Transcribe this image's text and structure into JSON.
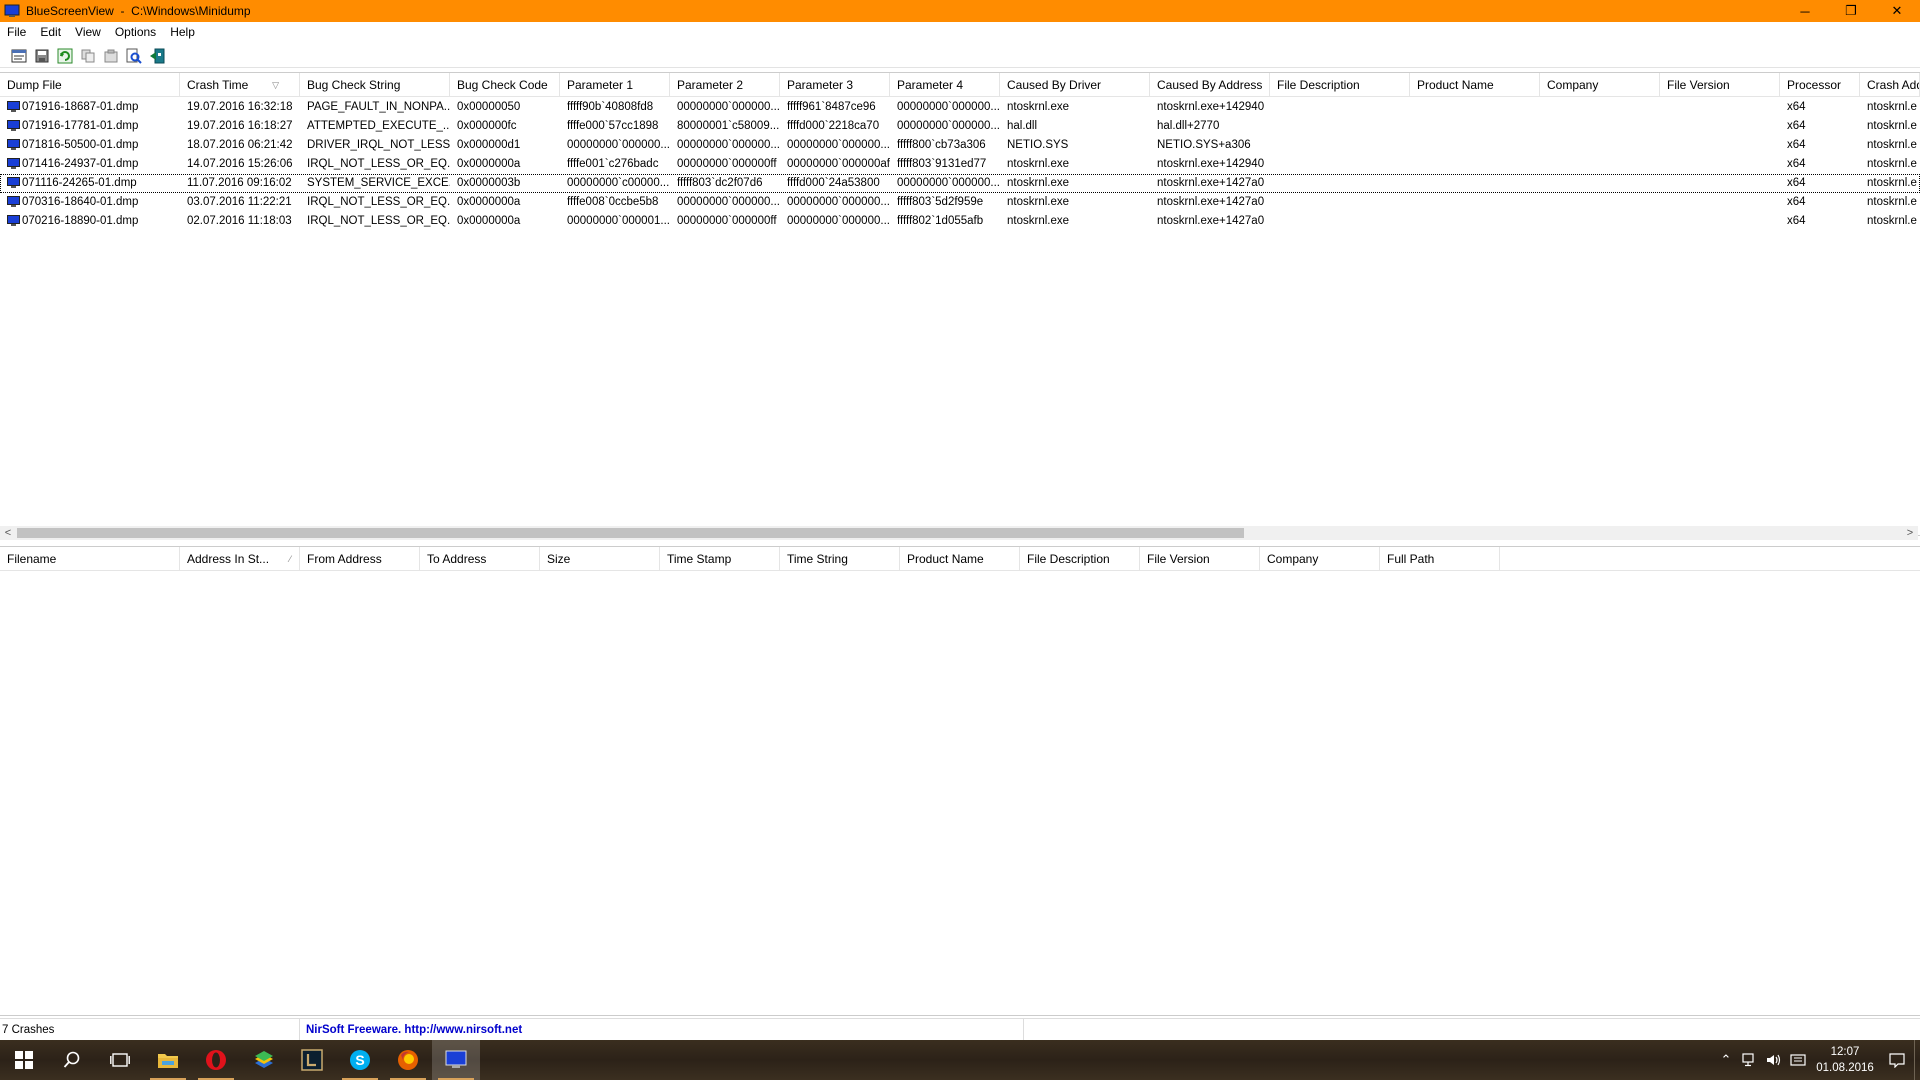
{
  "window": {
    "title": "BlueScreenView  -  C:\\Windows\\Minidump",
    "minimize": "─",
    "restore": "❐",
    "close": "✕"
  },
  "menu": [
    "File",
    "Edit",
    "View",
    "Options",
    "Help"
  ],
  "toolbar_icons": [
    "properties-icon",
    "save-icon",
    "refresh-icon",
    "copy-icon",
    "options-icon",
    "find-icon",
    "exit-icon"
  ],
  "upper_list": {
    "columns": [
      "Dump File",
      "Crash Time",
      "Bug Check String",
      "Bug Check Code",
      "Parameter 1",
      "Parameter 2",
      "Parameter 3",
      "Parameter 4",
      "Caused By Driver",
      "Caused By Address",
      "File Description",
      "Product Name",
      "Company",
      "File Version",
      "Processor",
      "Crash Add"
    ],
    "sorted_column": "Crash Time",
    "rows": [
      [
        "071916-18687-01.dmp",
        "19.07.2016 16:32:18",
        "PAGE_FAULT_IN_NONPA...",
        "0x00000050",
        "fffff90b`40808fd8",
        "00000000`000000...",
        "fffff961`8487ce96",
        "00000000`000000...",
        "ntoskrnl.exe",
        "ntoskrnl.exe+142940",
        "",
        "",
        "",
        "",
        "x64",
        "ntoskrnl.e"
      ],
      [
        "071916-17781-01.dmp",
        "19.07.2016 16:18:27",
        "ATTEMPTED_EXECUTE_...",
        "0x000000fc",
        "ffffe000`57cc1898",
        "80000001`c58009...",
        "ffffd000`2218ca70",
        "00000000`000000...",
        "hal.dll",
        "hal.dll+2770",
        "",
        "",
        "",
        "",
        "x64",
        "ntoskrnl.e"
      ],
      [
        "071816-50500-01.dmp",
        "18.07.2016 06:21:42",
        "DRIVER_IRQL_NOT_LESS...",
        "0x000000d1",
        "00000000`000000...",
        "00000000`000000...",
        "00000000`000000...",
        "fffff800`cb73a306",
        "NETIO.SYS",
        "NETIO.SYS+a306",
        "",
        "",
        "",
        "",
        "x64",
        "ntoskrnl.e"
      ],
      [
        "071416-24937-01.dmp",
        "14.07.2016 15:26:06",
        "IRQL_NOT_LESS_OR_EQ...",
        "0x0000000a",
        "ffffe001`c276badc",
        "00000000`000000ff",
        "00000000`000000af",
        "fffff803`9131ed77",
        "ntoskrnl.exe",
        "ntoskrnl.exe+142940",
        "",
        "",
        "",
        "",
        "x64",
        "ntoskrnl.e"
      ],
      [
        "071116-24265-01.dmp",
        "11.07.2016 09:16:02",
        "SYSTEM_SERVICE_EXCE...",
        "0x0000003b",
        "00000000`c00000...",
        "fffff803`dc2f07d6",
        "ffffd000`24a53800",
        "00000000`000000...",
        "ntoskrnl.exe",
        "ntoskrnl.exe+1427a0",
        "",
        "",
        "",
        "",
        "x64",
        "ntoskrnl.e"
      ],
      [
        "070316-18640-01.dmp",
        "03.07.2016 11:22:21",
        "IRQL_NOT_LESS_OR_EQ...",
        "0x0000000a",
        "ffffe008`0ccbe5b8",
        "00000000`000000...",
        "00000000`000000...",
        "fffff803`5d2f959e",
        "ntoskrnl.exe",
        "ntoskrnl.exe+1427a0",
        "",
        "",
        "",
        "",
        "x64",
        "ntoskrnl.e"
      ],
      [
        "070216-18890-01.dmp",
        "02.07.2016 11:18:03",
        "IRQL_NOT_LESS_OR_EQ...",
        "0x0000000a",
        "00000000`000001...",
        "00000000`000000ff",
        "00000000`000000...",
        "fffff802`1d055afb",
        "ntoskrnl.exe",
        "ntoskrnl.exe+1427a0",
        "",
        "",
        "",
        "",
        "x64",
        "ntoskrnl.e"
      ]
    ],
    "focused_row": 4
  },
  "lower_list": {
    "columns": [
      "Filename",
      "Address In St...",
      "From Address",
      "To Address",
      "Size",
      "Time Stamp",
      "Time String",
      "Product Name",
      "File Description",
      "File Version",
      "Company",
      "Full Path"
    ],
    "sorted_column": "Address In St..."
  },
  "status": {
    "count": "7 Crashes",
    "link": "NirSoft Freeware.  http://www.nirsoft.net"
  },
  "taskbar": {
    "apps": [
      "windows-start-icon",
      "search-icon",
      "task-view-icon",
      "file-explorer-icon",
      "opera-icon",
      "bluestacks-icon",
      "league-launcher-icon",
      "skype-icon",
      "firefox-icon",
      "bluescreenview-icon"
    ],
    "time": "12:07",
    "date": "01.08.2016"
  },
  "colors": {
    "titlebar": "#ff8c00",
    "link": "#0000cc"
  }
}
